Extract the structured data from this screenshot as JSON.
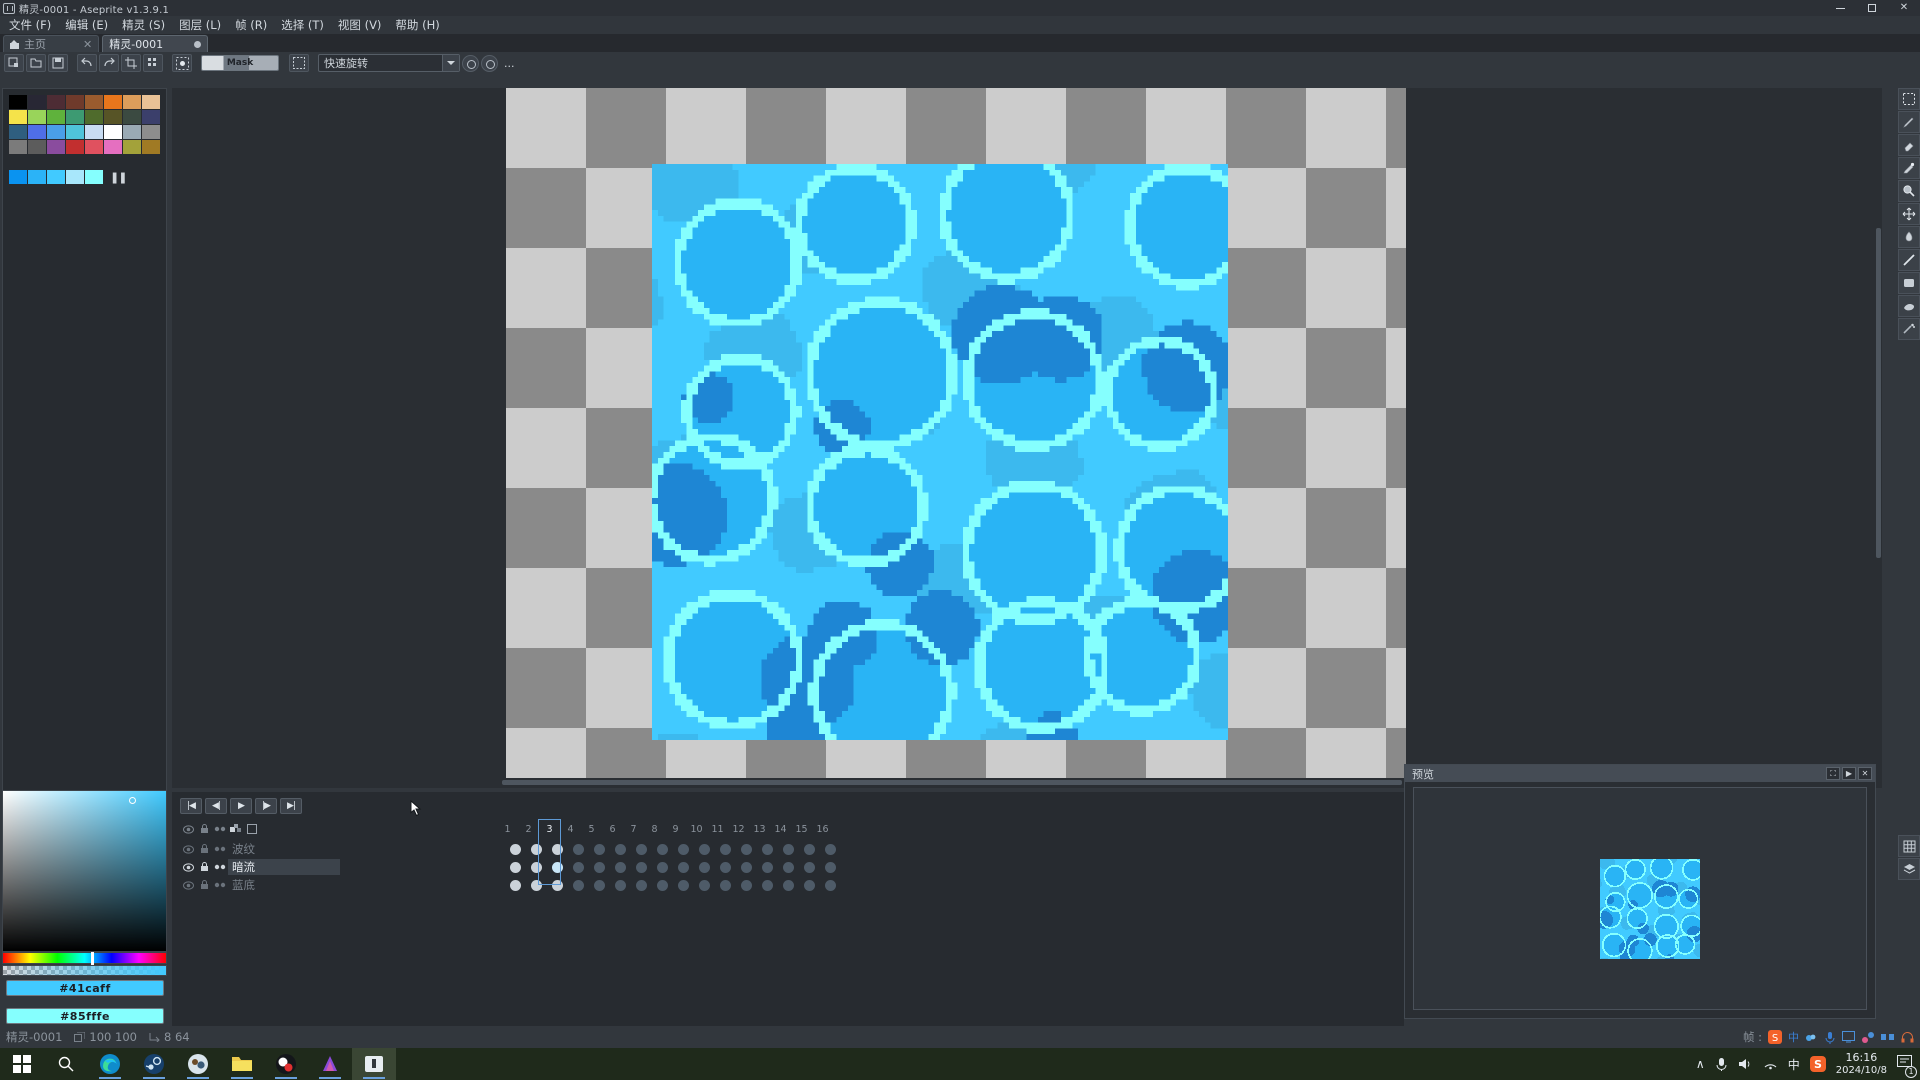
{
  "window": {
    "title": "精灵-0001 - Aseprite v1.3.9.1",
    "icon": "aseprite-icon",
    "minimize_label": "—",
    "maximize_label": "▢",
    "close_label": "✕"
  },
  "menu": {
    "items": [
      {
        "label": "文件 (F)",
        "name": "menu-file"
      },
      {
        "label": "编辑 (E)",
        "name": "menu-edit"
      },
      {
        "label": "精灵 (S)",
        "name": "menu-sprite"
      },
      {
        "label": "图层 (L)",
        "name": "menu-layer"
      },
      {
        "label": "帧 (R)",
        "name": "menu-frame"
      },
      {
        "label": "选择 (T)",
        "name": "menu-select"
      },
      {
        "label": "视图 (V)",
        "name": "menu-view"
      },
      {
        "label": "帮助 (H)",
        "name": "menu-help"
      }
    ]
  },
  "tabs": [
    {
      "label": "主页",
      "icon": "home-icon",
      "closable": true,
      "active": false
    },
    {
      "label": "精灵-0001",
      "icon": "modified-dot",
      "closable": false,
      "active": true
    }
  ],
  "toolbar": {
    "mask_label": "Mask",
    "rotate_label": "快速旋转",
    "more_label": "...",
    "buttons": [
      {
        "name": "new-sprite-button"
      },
      {
        "name": "open-sprite-button"
      },
      {
        "name": "save-sprite-button"
      },
      {
        "name": "undo-button"
      },
      {
        "name": "redo-button"
      },
      {
        "name": "crop-button"
      },
      {
        "name": "grid-button"
      },
      {
        "name": "pixel-grid-button"
      },
      {
        "name": "selection-mode-button"
      }
    ]
  },
  "palette": {
    "colors": [
      "#000000",
      "#282734",
      "#4d2c34",
      "#6f3a2b",
      "#9a5b2e",
      "#e8761c",
      "#dd9d5b",
      "#e9c296",
      "#f5e34a",
      "#99d45a",
      "#5fb23c",
      "#3d9a72",
      "#4f6b2c",
      "#575426",
      "#3b4a41",
      "#3b3f6b",
      "#2f5e7f",
      "#4f6ee8",
      "#4a9fe8",
      "#4fc4da",
      "#c8dcf2",
      "#ffffff",
      "#9aaab4",
      "#8d8d8d",
      "#7b7b7b",
      "#5c5c5c",
      "#8a4c9e",
      "#c22f2f",
      "#e0515f",
      "#e56fc0",
      "#a3a23a",
      "#a07a24",
      "#0a93f0",
      "#2bb3f7",
      "#41caff",
      "#a8e7fb",
      "#85fffe"
    ],
    "pause_label": "❚❚"
  },
  "color": {
    "foreground_hex": "#41caff",
    "background_hex": "#85fffe",
    "fg_label": "#41caff",
    "bg_label": "#85fffe"
  },
  "tools": {
    "right_strip": [
      {
        "name": "rectangular-marquee-icon",
        "selected": false
      },
      {
        "name": "pencil-icon",
        "selected": false
      },
      {
        "name": "eraser-icon",
        "selected": false
      },
      {
        "name": "eyedropper-icon",
        "selected": false
      },
      {
        "name": "zoom-icon",
        "selected": false
      },
      {
        "name": "move-icon",
        "selected": false
      },
      {
        "name": "paint-bucket-icon",
        "selected": false
      },
      {
        "name": "line-icon",
        "selected": false
      },
      {
        "name": "rectangle-icon",
        "selected": false
      },
      {
        "name": "contour-icon",
        "selected": false
      },
      {
        "name": "blur-icon",
        "selected": false
      }
    ],
    "bottom_strip": [
      {
        "name": "grid-settings-icon"
      },
      {
        "name": "layer-settings-icon"
      }
    ]
  },
  "timeline": {
    "playback": [
      {
        "name": "goto-first-frame-button",
        "glyph": "|◀"
      },
      {
        "name": "previous-frame-button",
        "glyph": "◀|"
      },
      {
        "name": "play-button",
        "glyph": "▶"
      },
      {
        "name": "next-frame-button",
        "glyph": "|▶"
      },
      {
        "name": "goto-last-frame-button",
        "glyph": "▶|"
      }
    ],
    "header_icons": [
      {
        "name": "toggle-all-visibility-icon"
      },
      {
        "name": "toggle-all-lock-icon"
      },
      {
        "name": "toggle-all-continuous-icon"
      },
      {
        "name": "onion-skin-icon"
      },
      {
        "name": "new-layer-icon"
      }
    ],
    "frame_numbers": [
      "1",
      "2",
      "3",
      "4",
      "5",
      "6",
      "7",
      "8",
      "9",
      "10",
      "11",
      "12",
      "13",
      "14",
      "15",
      "16"
    ],
    "current_frame": "3",
    "layers": [
      {
        "name": "波纹",
        "visible": true,
        "locked": false,
        "continuous": true,
        "selected": false,
        "cels": [
          true,
          true,
          true,
          true,
          true,
          true,
          true,
          true,
          true,
          true,
          true,
          true,
          true,
          true,
          true,
          true
        ]
      },
      {
        "name": "暗流",
        "visible": true,
        "locked": false,
        "continuous": true,
        "selected": true,
        "cels": [
          true,
          true,
          true,
          true,
          true,
          true,
          true,
          true,
          true,
          true,
          true,
          true,
          true,
          true,
          true,
          true
        ]
      },
      {
        "name": "蓝底",
        "visible": true,
        "locked": false,
        "continuous": true,
        "selected": false,
        "cels": [
          true,
          true,
          true,
          true,
          true,
          true,
          true,
          true,
          true,
          true,
          true,
          true,
          true,
          true,
          true,
          true
        ]
      }
    ]
  },
  "preview": {
    "title": "预览",
    "buttons": [
      {
        "name": "fit-preview-button",
        "glyph": "⛶"
      },
      {
        "name": "play-preview-button",
        "glyph": "▶"
      },
      {
        "name": "close-preview-button",
        "glyph": "✕"
      }
    ]
  },
  "status": {
    "sprite_name": "精灵-0001",
    "size_label": "100 100",
    "frames_label": "8 64",
    "frame_label": "帧 :"
  },
  "taskbar": {
    "items": [
      {
        "name": "start-button",
        "icon": "windows-logo-icon"
      },
      {
        "name": "search-button",
        "icon": "search-icon"
      },
      {
        "name": "taskbar-edge",
        "icon": "edge-icon",
        "running": true
      },
      {
        "name": "taskbar-steam",
        "icon": "steam-icon",
        "running": true
      },
      {
        "name": "taskbar-game",
        "icon": "game-icon",
        "running": true
      },
      {
        "name": "taskbar-explorer",
        "icon": "folder-icon",
        "running": true
      },
      {
        "name": "taskbar-obs",
        "icon": "obs-icon",
        "running": true
      },
      {
        "name": "taskbar-app",
        "icon": "purple-app-icon",
        "running": true
      },
      {
        "name": "taskbar-aseprite",
        "icon": "aseprite-icon",
        "running": true,
        "active": true
      }
    ],
    "tray": {
      "expand": "∧",
      "icons": [
        "microphone-icon",
        "volume-icon",
        "network-icon",
        "ime-cn-icon",
        "sogou-icon"
      ],
      "time": "16:16",
      "date": "2024/10/8",
      "notification_count": "1"
    }
  },
  "canvas": {
    "sprite_width": 100,
    "sprite_height": 100,
    "water_colors": {
      "base": "#29b4f5",
      "light": "#41caff",
      "highlight": "#85fffe",
      "dark": "#1e86d4",
      "mid": "#3cb9ee"
    }
  }
}
